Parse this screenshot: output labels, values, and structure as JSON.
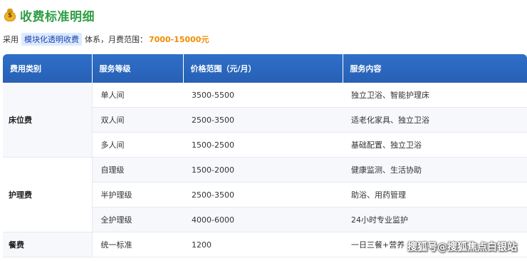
{
  "header": {
    "title": "收费标准明细",
    "icon": "money-bag-icon",
    "title_color": "#2f9e44"
  },
  "subline": {
    "prefix": "采用",
    "highlight": "模块化透明收费",
    "middle": "体系，月费范围：",
    "range": "7000-15000元"
  },
  "table": {
    "headers": [
      "费用类别",
      "服务等级",
      "价格范围（元/月）",
      "服务内容"
    ],
    "groups": [
      {
        "category": "床位费",
        "rows": [
          {
            "level": "单人间",
            "price": "3500-5500",
            "content": "独立卫浴、智能护理床"
          },
          {
            "level": "双人间",
            "price": "2500-3500",
            "content": "适老化家具、独立卫浴"
          },
          {
            "level": "多人间",
            "price": "1500-2500",
            "content": "基础配置、独立卫浴"
          }
        ]
      },
      {
        "category": "护理费",
        "rows": [
          {
            "level": "自理级",
            "price": "1500-2000",
            "content": "健康监测、生活协助"
          },
          {
            "level": "半护理级",
            "price": "2500-3500",
            "content": "助浴、用药管理"
          },
          {
            "level": "全护理级",
            "price": "4000-6000",
            "content": "24小时专业监护"
          }
        ]
      },
      {
        "category": "餐费",
        "rows": [
          {
            "level": "统一标准",
            "price": "1200",
            "content": "一日三餐+营养"
          }
        ]
      }
    ],
    "header_color": "#2f6fc8"
  },
  "watermark": "搜狐号@搜狐焦点白银站"
}
